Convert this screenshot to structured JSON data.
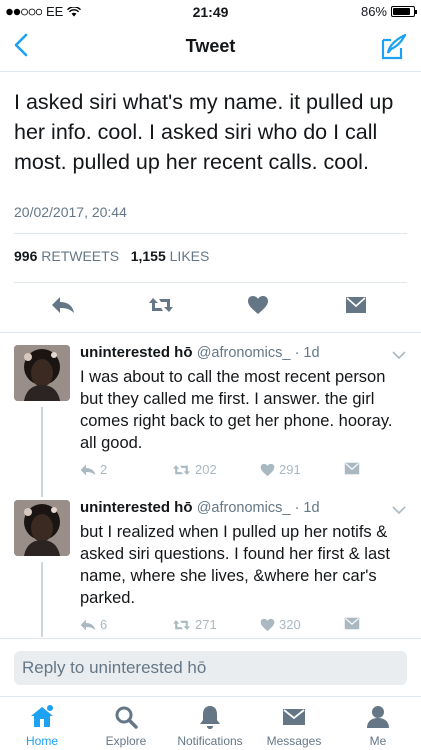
{
  "status_bar": {
    "carrier": "EE",
    "time": "21:49",
    "battery": "86%",
    "battery_level": 0.86
  },
  "nav": {
    "title": "Tweet"
  },
  "tweet": {
    "text": "I asked siri what's my name. it pulled up her info. cool. I asked siri who do I call most. pulled up her recent calls. cool.",
    "timestamp": "20/02/2017, 20:44",
    "retweets_count": "996",
    "retweets_label": "RETWEETS",
    "likes_count": "1,155",
    "likes_label": "LIKES"
  },
  "replies": [
    {
      "name": "uninterested hō",
      "handle": "@afronomics_",
      "time": "· 1d",
      "text": "I was about to call the most recent person but they called me first. I answer. the girl comes right back to get her phone. hooray. all good.",
      "replies": "2",
      "retweets": "202",
      "likes": "291"
    },
    {
      "name": "uninterested hō",
      "handle": "@afronomics_",
      "time": "· 1d",
      "text": "but I realized when I pulled up her notifs & asked siri questions. I found her first & last name, where she lives, &where her car's parked.",
      "replies": "6",
      "retweets": "271",
      "likes": "320"
    }
  ],
  "reply_box": {
    "placeholder": "Reply to uninterested hō"
  },
  "tabbar": {
    "items": [
      {
        "label": "Home",
        "icon": "home-icon",
        "active": true
      },
      {
        "label": "Explore",
        "icon": "search-icon",
        "active": false
      },
      {
        "label": "Notifications",
        "icon": "bell-icon",
        "active": false
      },
      {
        "label": "Messages",
        "icon": "envelope-icon",
        "active": false
      },
      {
        "label": "Me",
        "icon": "person-icon",
        "active": false
      }
    ]
  },
  "colors": {
    "accent": "#1da1f2",
    "text": "#14171a",
    "muted": "#657786",
    "icon_gray": "#657786",
    "light_gray": "#aab8c2",
    "divider": "#e1e8ed"
  }
}
